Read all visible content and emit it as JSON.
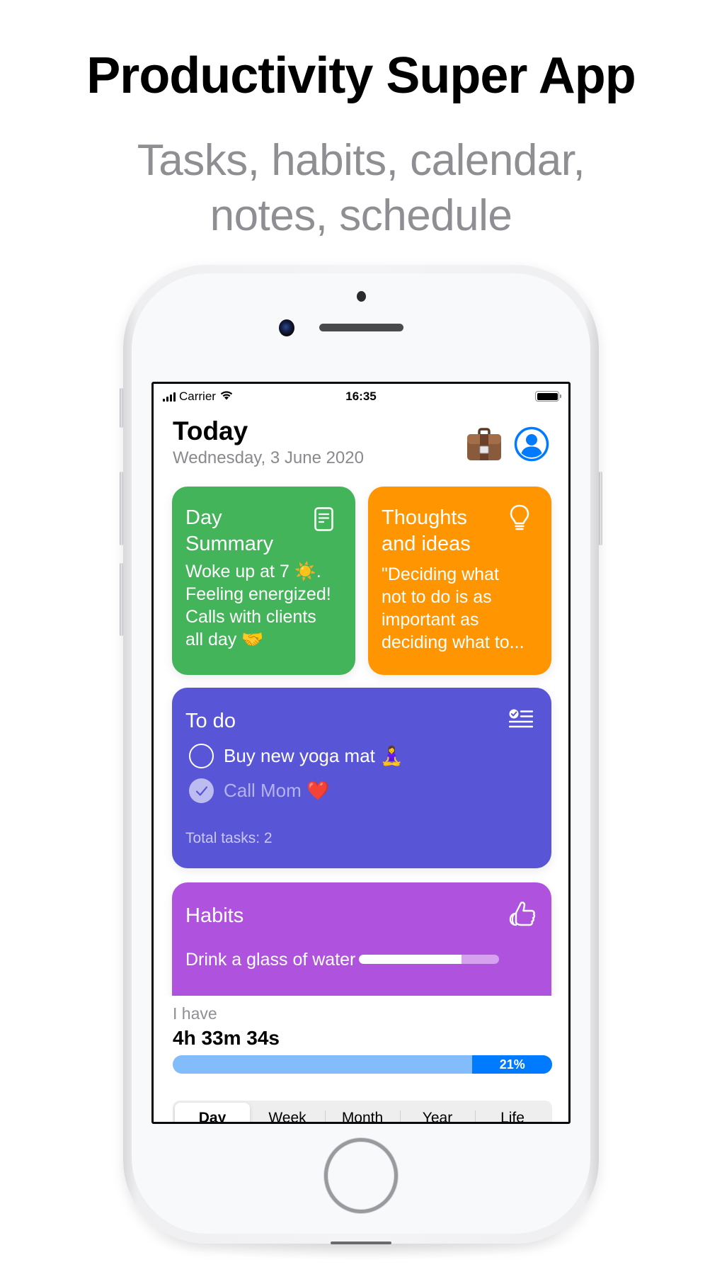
{
  "promo": {
    "title": "Productivity Super App",
    "subtitle_line1": "Tasks, habits, calendar,",
    "subtitle_line2": "notes, schedule"
  },
  "status_bar": {
    "carrier": "Carrier",
    "time": "16:35",
    "icons": [
      "signal-icon",
      "wifi-icon",
      "battery-icon"
    ]
  },
  "header": {
    "title": "Today",
    "date": "Wednesday, 3 June 2020",
    "icons": [
      "briefcase-icon",
      "profile-icon"
    ]
  },
  "cards": {
    "day_summary": {
      "title": "Day Summary",
      "icon": "document-icon",
      "body_lines": [
        "Woke up at 7 ☀️.",
        "Feeling energized!",
        "Calls with clients",
        "all day 🤝"
      ],
      "color": "#43b45a"
    },
    "thoughts": {
      "title_line1": "Thoughts",
      "title_line2": "and ideas",
      "icon": "lightbulb-icon",
      "body_lines": [
        "\"Deciding what",
        "not to do is as",
        "important as",
        "deciding what to..."
      ],
      "color": "#ff9500"
    },
    "todo": {
      "title": "To do",
      "icon": "checklist-icon",
      "items": [
        {
          "text": "Buy new yoga mat 🧘‍♀️",
          "done": false
        },
        {
          "text": "Call Mom ❤️",
          "done": true
        }
      ],
      "total": "Total tasks: 2",
      "color": "#5856d6"
    },
    "habits": {
      "title": "Habits",
      "icon": "thumbs-up-icon",
      "items": [
        {
          "name": "Drink a glass of water",
          "progress": 0.73
        }
      ],
      "color": "#af52de"
    }
  },
  "time_left": {
    "label": "I have",
    "value": "4h 33m 34s",
    "percent_label": "21%",
    "percent": 21,
    "accent": "#007aff"
  },
  "period_tabs": {
    "options": [
      "Day",
      "Week",
      "Month",
      "Year",
      "Life"
    ],
    "selected": "Day"
  }
}
